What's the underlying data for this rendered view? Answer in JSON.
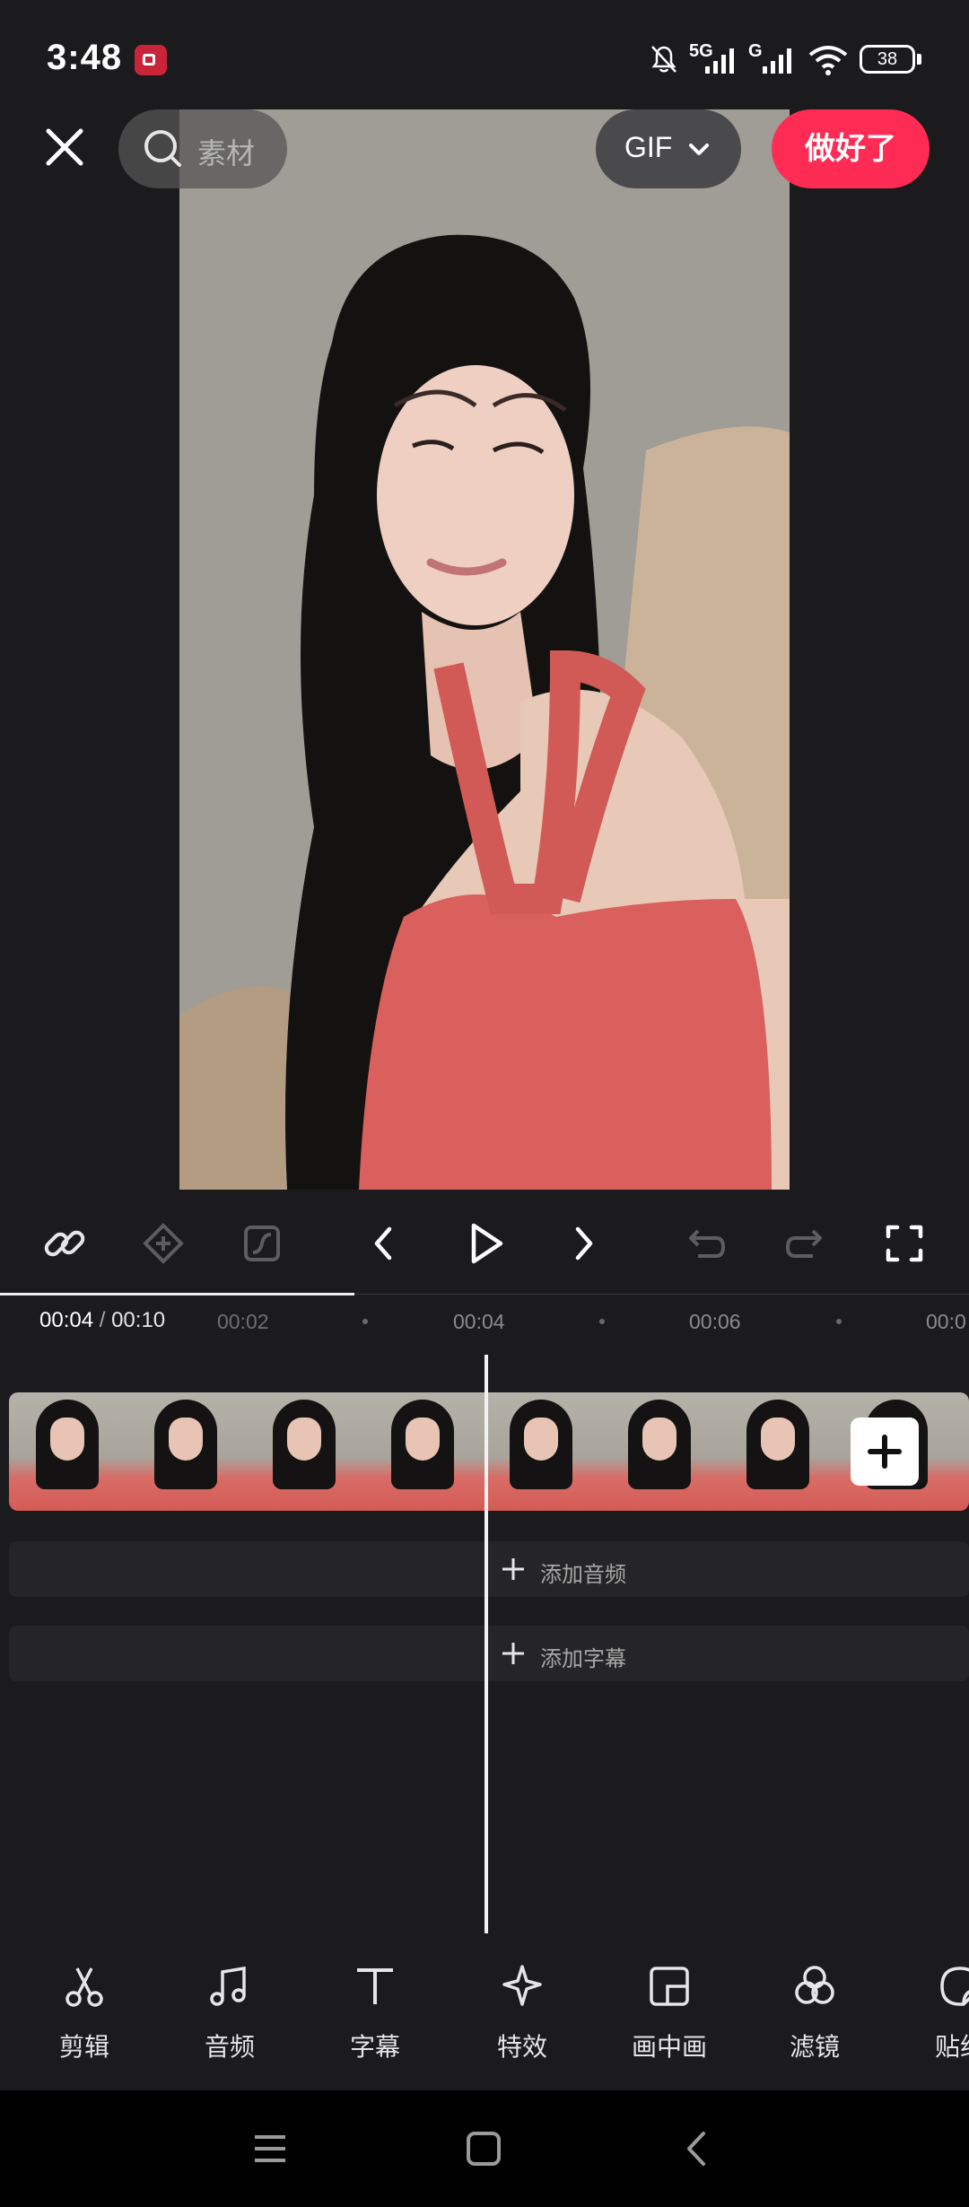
{
  "status_bar": {
    "time": "3:48",
    "net1": "5G",
    "net2": "G",
    "battery": "38"
  },
  "top_bar": {
    "search_placeholder": "素材",
    "format_label": "GIF",
    "done_label": "做好了"
  },
  "timeline": {
    "current_time": "00:04",
    "separator": "/",
    "total_time": "00:10",
    "ticks": [
      "00:02",
      "00:04",
      "00:06",
      "00:0"
    ],
    "progress": 0.4,
    "add_audio": "添加音频",
    "add_caption": "添加字幕"
  },
  "toolbar": {
    "items": [
      {
        "label": "剪辑",
        "icon": "scissors-icon"
      },
      {
        "label": "音频",
        "icon": "music-note-icon"
      },
      {
        "label": "字幕",
        "icon": "text-icon"
      },
      {
        "label": "特效",
        "icon": "sparkle-icon"
      },
      {
        "label": "画中画",
        "icon": "picture-in-picture-icon"
      },
      {
        "label": "滤镜",
        "icon": "filter-circles-icon"
      },
      {
        "label": "贴纸",
        "icon": "sticker-icon"
      }
    ]
  },
  "colors": {
    "background": "#1b1b1d",
    "accent": "#fe2c55",
    "recording": "#c9253a"
  }
}
